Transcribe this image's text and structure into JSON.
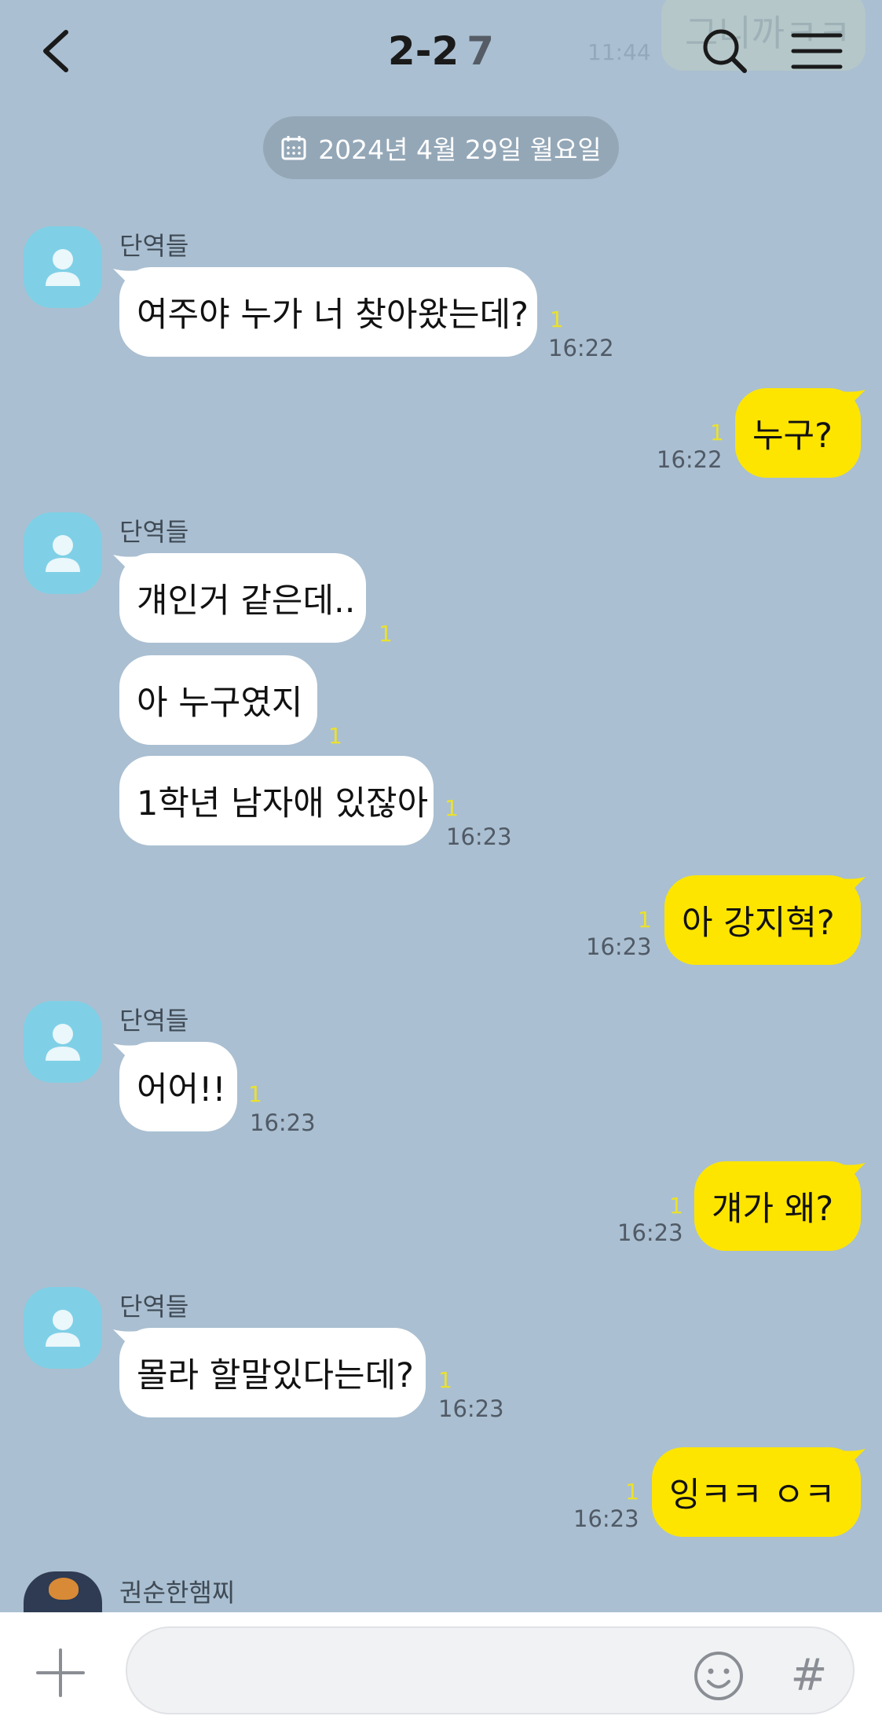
{
  "header": {
    "title": "2-2",
    "member_count": "7",
    "ghost_message": "그니까ㅋㅋ",
    "ghost_time": "11:44",
    "back_icon": "chevron-left-icon",
    "search_icon": "search-icon",
    "menu_icon": "hamburger-menu-icon"
  },
  "date_divider": {
    "icon": "calendar-icon",
    "label": "2024년 4월 29일 월요일"
  },
  "messages": [
    {
      "side": "in",
      "sender": "단역들",
      "text": "여주야 누가 너 찾아왔는데?",
      "unread": "1",
      "time": "16:22"
    },
    {
      "side": "out",
      "text": "누구?",
      "unread": "1",
      "time": "16:22"
    },
    {
      "side": "in",
      "sender": "단역들",
      "text": "걔인거 같은데..",
      "unread": "1",
      "time": ""
    },
    {
      "side": "in",
      "text": "아 누구였지",
      "unread": "1",
      "time": ""
    },
    {
      "side": "in",
      "text": "1학년 남자애 있잖아",
      "unread": "1",
      "time": "16:23"
    },
    {
      "side": "out",
      "text": "아 강지혁?",
      "unread": "1",
      "time": "16:23"
    },
    {
      "side": "in",
      "sender": "단역들",
      "text": "어어!!",
      "unread": "1",
      "time": "16:23"
    },
    {
      "side": "out",
      "text": "걔가 왜?",
      "unread": "1",
      "time": "16:23"
    },
    {
      "side": "in",
      "sender": "단역들",
      "text": "몰라 할말있다는데?",
      "unread": "1",
      "time": "16:23"
    },
    {
      "side": "out",
      "text": "잉ㅋㅋ ㅇㅋ",
      "unread": "1",
      "time": "16:23"
    }
  ],
  "next_sender": "권순한햄찌",
  "input_bar": {
    "value": "",
    "plus_icon": "plus-icon",
    "emoji_icon": "emoji-icon",
    "hash_icon": "hashtag-icon",
    "hash_label": "#"
  },
  "colors": {
    "background": "#aabfd1",
    "incoming_bubble": "#ffffff",
    "outgoing_bubble": "#fee500",
    "unread": "#ebe12c",
    "avatar": "#7fd0e6"
  }
}
